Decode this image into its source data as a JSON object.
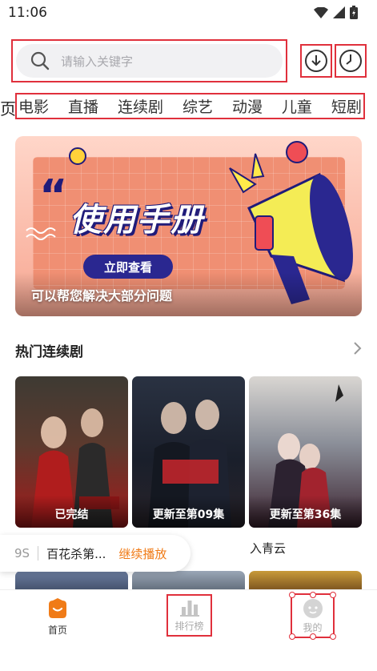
{
  "status_bar": {
    "time": "11:06"
  },
  "search": {
    "placeholder": "请输入关键字"
  },
  "categories": {
    "prev_partial": "页",
    "tabs": [
      "电影",
      "直播",
      "连续剧",
      "综艺",
      "动漫",
      "儿童",
      "短剧"
    ]
  },
  "banner": {
    "quote_mark": "“",
    "title": "使用手册",
    "button_label": "立即查看",
    "subtitle": "可以帮您解决大部分问题"
  },
  "section": {
    "title": "热门连续剧"
  },
  "posters": [
    {
      "caption": "已完结",
      "title": ""
    },
    {
      "caption": "更新至第09集",
      "title": ""
    },
    {
      "caption": "更新至第36集",
      "title": "入青云"
    }
  ],
  "resume": {
    "episode": "9S",
    "title": "百花杀第...",
    "action": "继续播放"
  },
  "tabbar": {
    "home": "首页",
    "rank": "排行榜",
    "me": "我的"
  },
  "colors": {
    "accent_orange": "#f07b17",
    "highlight_red": "#e0303c"
  }
}
